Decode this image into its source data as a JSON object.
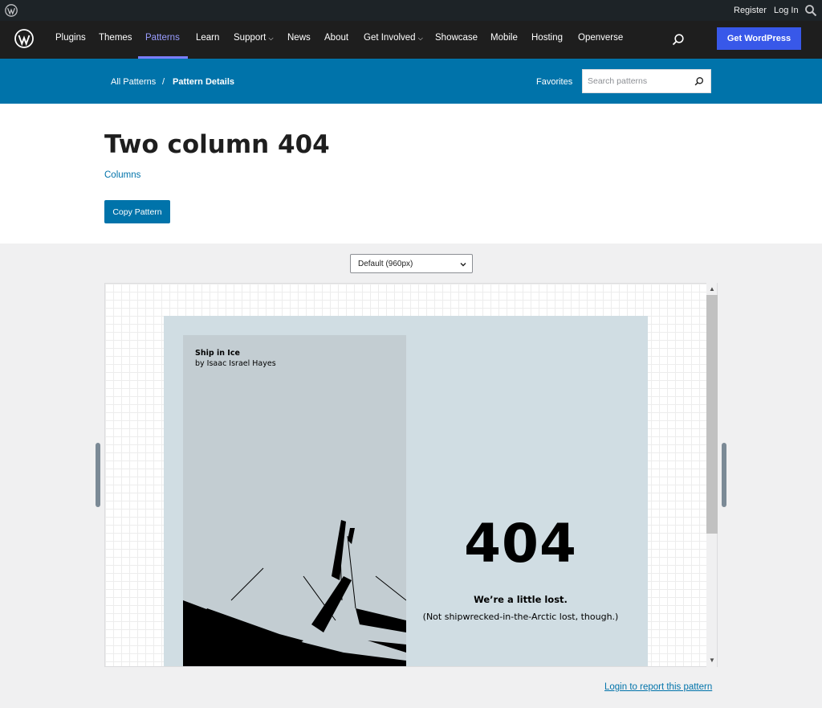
{
  "admin_bar": {
    "register": "Register",
    "login": "Log In"
  },
  "global_nav": {
    "items": [
      {
        "label": "Plugins"
      },
      {
        "label": "Themes"
      },
      {
        "label": "Patterns",
        "active": true
      },
      {
        "label": "Learn"
      },
      {
        "label": "Support",
        "has_dropdown": true
      },
      {
        "label": "News"
      },
      {
        "label": "About"
      },
      {
        "label": "Get Involved",
        "has_dropdown": true
      },
      {
        "label": "Showcase"
      },
      {
        "label": "Mobile"
      },
      {
        "label": "Hosting"
      },
      {
        "label": "Openverse"
      }
    ],
    "cta": "Get WordPress",
    "accent_color": "#3858e9"
  },
  "local_nav": {
    "breadcrumb": [
      "All Patterns",
      "/",
      "Pattern Details"
    ],
    "favorites": "Favorites",
    "search_placeholder": "Search patterns",
    "bg_color": "#0073aa"
  },
  "pattern": {
    "title": "Two column 404",
    "category": "Columns",
    "copy_button": "Copy Pattern"
  },
  "preview": {
    "width_select": "Default (960px)",
    "image_title": "Ship in Ice",
    "image_author": "by Isaac Israel Hayes",
    "heading": "404",
    "subheading": "We’re a little lost.",
    "body": "(Not shipwrecked-in-the-Arctic lost, though.)"
  },
  "footer": {
    "report_link": "Login to report this pattern"
  }
}
